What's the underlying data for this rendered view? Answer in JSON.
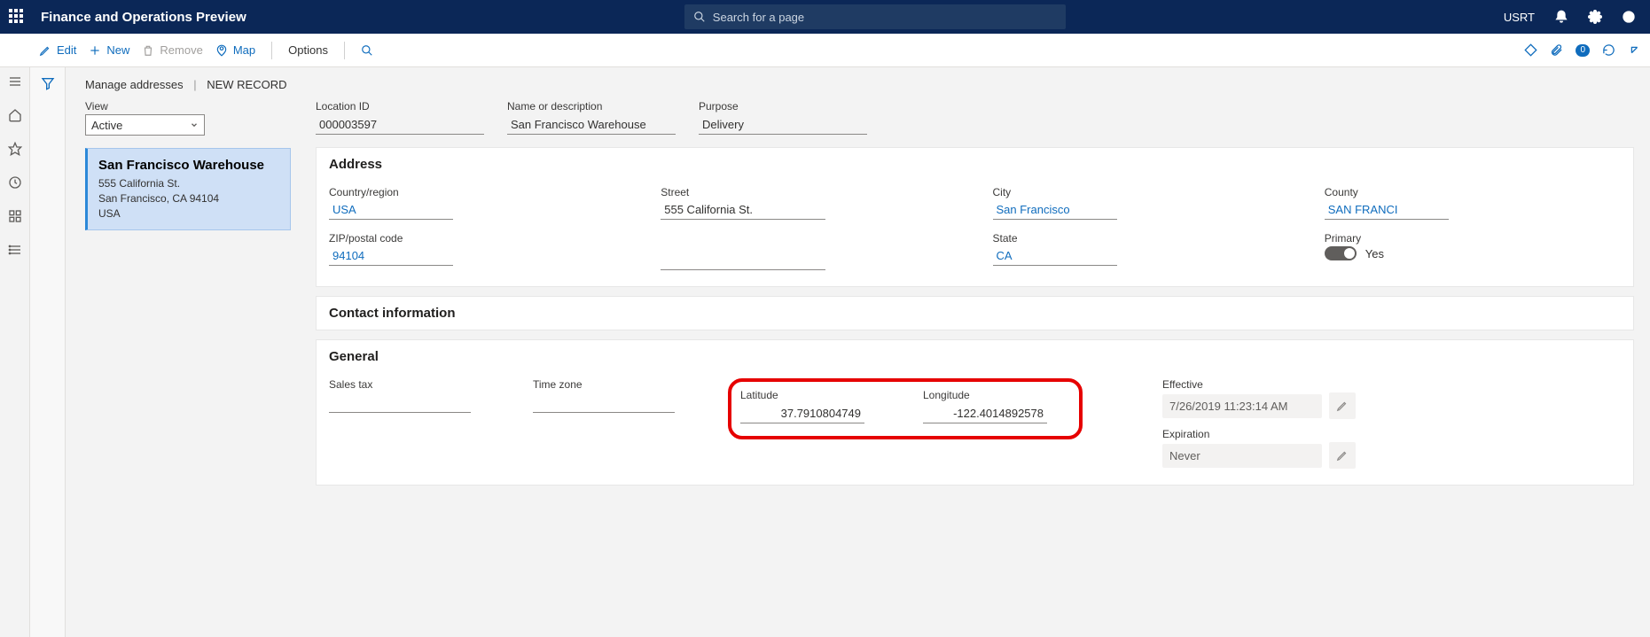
{
  "nav": {
    "title": "Finance and Operations Preview",
    "search_placeholder": "Search for a page",
    "user": "USRT"
  },
  "actions": {
    "edit": "Edit",
    "new": "New",
    "remove": "Remove",
    "map": "Map",
    "options": "Options",
    "badge": "0"
  },
  "breadcrumb": {
    "a": "Manage addresses",
    "b": "NEW RECORD"
  },
  "view": {
    "label": "View",
    "value": "Active"
  },
  "card": {
    "title": "San Francisco Warehouse",
    "l1": "555 California St.",
    "l2": "San Francisco, CA 94104",
    "l3": "USA"
  },
  "header": {
    "location_id_label": "Location ID",
    "location_id": "000003597",
    "name_label": "Name or description",
    "name": "San Francisco Warehouse",
    "purpose_label": "Purpose",
    "purpose": "Delivery"
  },
  "sections": {
    "address": "Address",
    "contact": "Contact information",
    "general": "General"
  },
  "address": {
    "country_label": "Country/region",
    "country": "USA",
    "zip_label": "ZIP/postal code",
    "zip": "94104",
    "street_label": "Street",
    "street": "555 California St.",
    "city_label": "City",
    "city": "San Francisco",
    "state_label": "State",
    "state": "CA",
    "county_label": "County",
    "county": "SAN FRANCI",
    "primary_label": "Primary",
    "primary_text": "Yes"
  },
  "general": {
    "salestax_label": "Sales tax",
    "timezone_label": "Time zone",
    "lat_label": "Latitude",
    "lat": "37.7910804749",
    "lon_label": "Longitude",
    "lon": "-122.4014892578",
    "effective_label": "Effective",
    "effective": "7/26/2019 11:23:14 AM",
    "expiration_label": "Expiration",
    "expiration": "Never"
  }
}
